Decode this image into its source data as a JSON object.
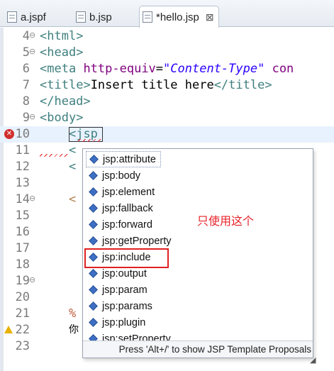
{
  "tabs": [
    {
      "label": "a.jspf",
      "active": false
    },
    {
      "label": "b.jsp",
      "active": false
    },
    {
      "label": "*hello.jsp",
      "active": true,
      "close": "⊠"
    }
  ],
  "editor": {
    "line_numbers": [
      "4",
      "5",
      "6",
      "7",
      "8",
      "9",
      "10",
      "11",
      "12",
      "13",
      "14",
      "15",
      "16",
      "17",
      "18",
      "19",
      "20",
      "21",
      "22",
      "23"
    ],
    "line4": {
      "open": "<",
      "tag": "html",
      "close": ">"
    },
    "line5": {
      "open": "<",
      "tag": "head",
      "close": ">"
    },
    "line6": {
      "open": "<",
      "tag": "meta",
      "attr": " http-equiv",
      "eq": "=",
      "str": "\"Content-Type\"",
      "tail_attr": " con"
    },
    "line7": {
      "open": "<",
      "tag": "title",
      "close": ">",
      "text": "Insert title here",
      "end": "</title>"
    },
    "line8": {
      "text": "</head>"
    },
    "line9": {
      "open": "<",
      "tag": "body",
      "close": ">"
    },
    "line10": {
      "indent": "    ",
      "open": "<",
      "typed": "jsp"
    },
    "fragments": {
      "line11": "<",
      "line12": "<",
      "line14": "<",
      "line21": "%",
      "line22": "你"
    }
  },
  "assist": {
    "items": [
      "jsp:attribute",
      "jsp:body",
      "jsp:element",
      "jsp:fallback",
      "jsp:forward",
      "jsp:getProperty",
      "jsp:include",
      "jsp:output",
      "jsp:param",
      "jsp:params",
      "jsp:plugin",
      "jsp:setProperty"
    ],
    "selected_index": 0,
    "status": "Press 'Alt+/' to show JSP Template Proposals"
  },
  "annotation": {
    "note": "只使用这个",
    "highlighted_item": "jsp:include",
    "color": "#e02020"
  },
  "colors": {
    "tag": "#3f7f7f",
    "attribute": "#7f007f",
    "string": "#2a00ff",
    "current_line": "#e8f2fe",
    "error": "#d12f2f"
  }
}
